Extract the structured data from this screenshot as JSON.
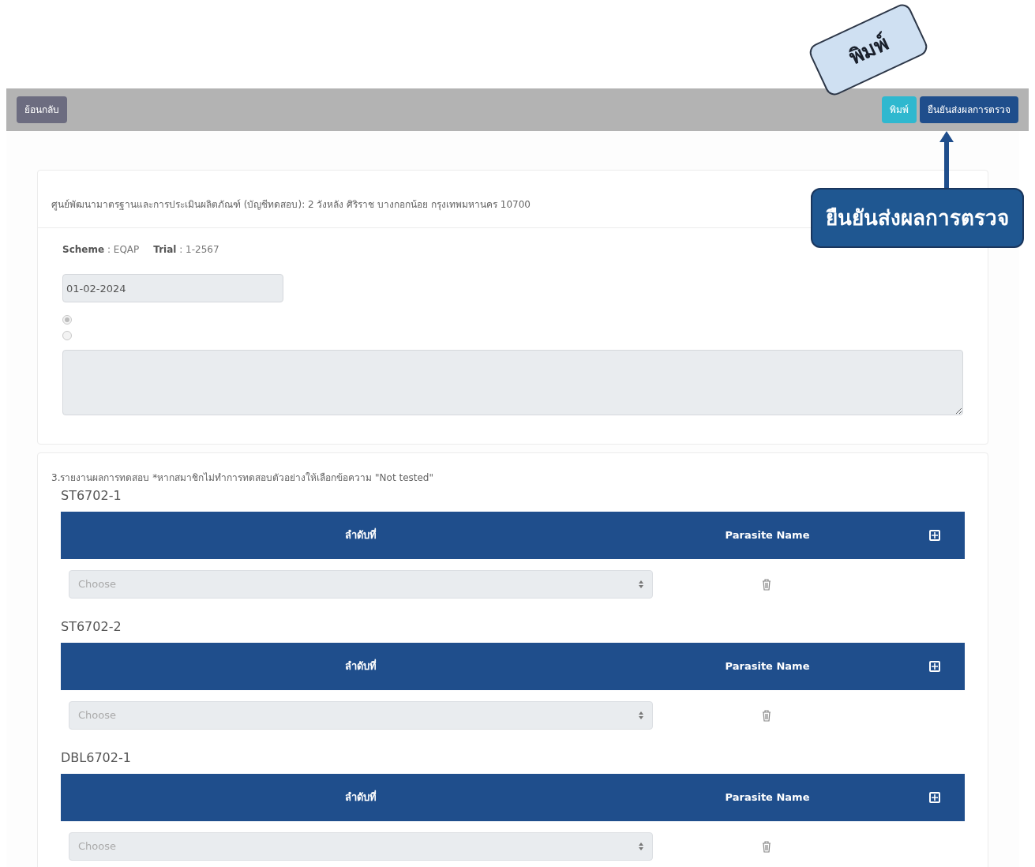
{
  "toolbar": {
    "back_button": "ย้อนกลับ",
    "print_button": "พิมพ์",
    "confirm_button": "ยืนยันส่งผลการตรวจ"
  },
  "annotations": [
    {
      "kind": "bubble",
      "text": "พิมพ์"
    },
    {
      "kind": "box",
      "text": "ยืนยันส่งผลการตรวจ"
    }
  ],
  "info_card": {
    "address": "ศูนย์พัฒนามาตรฐานและการประเมินผลิตภัณฑ์ (บัญชีทดสอบ): 2 วังหลัง ศิริราช บางกอกน้อย กรุงเทพมหานคร 10700",
    "separator": ":",
    "scheme_label": "Scheme",
    "scheme_value": "EQAP",
    "trial_label": "Trial",
    "trial_value": "1-2567",
    "date_value": "01-02-2024",
    "radios": [
      {
        "selected": true
      },
      {
        "selected": false
      }
    ]
  },
  "results": {
    "heading": "3.รายงานผลการทดสอบ *หากสมาชิกไม่ทำการทดสอบตัวอย่างให้เลือกข้อความ \"Not tested\"",
    "samples": [
      {
        "code": "ST6702-1",
        "columns": [
          "ลำดับที่",
          "Parasite Name"
        ],
        "rows": [
          {
            "placeholder": "Choose"
          }
        ]
      },
      {
        "code": "ST6702-2",
        "columns": [
          "ลำดับที่",
          "Parasite Name"
        ],
        "rows": [
          {
            "placeholder": "Choose"
          }
        ]
      },
      {
        "code": "DBL6702-1",
        "columns": [
          "ลำดับที่",
          "Parasite Name"
        ],
        "rows": [
          {
            "placeholder": "Choose"
          }
        ]
      }
    ]
  }
}
